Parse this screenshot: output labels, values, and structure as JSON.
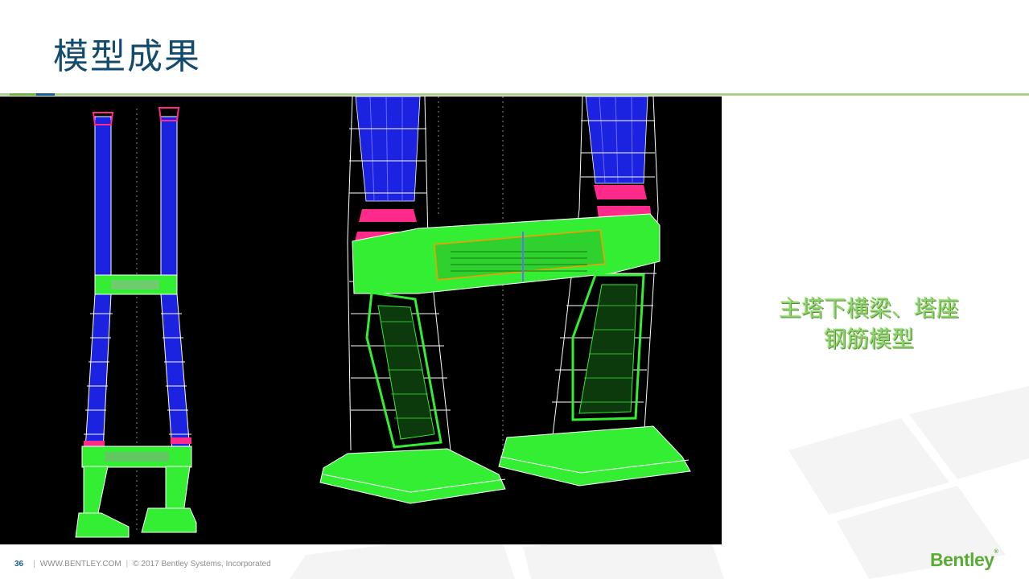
{
  "slide": {
    "title": "模型成果",
    "caption_line1": "主塔下横梁、塔座",
    "caption_line2": "钢筋模型",
    "footer": {
      "page_number": "36",
      "website": "WWW.BENTLEY.COM",
      "copyright": "© 2017 Bentley Systems, Incorporated"
    },
    "logo_text": "Bentley",
    "logo_mark": "®"
  },
  "colors": {
    "title": "#124b6e",
    "rule": "#a8d08d",
    "caption": "#8ed36b",
    "logo": "#5cab37",
    "rebar_green": "#33ee33",
    "rebar_blue": "#1b22e0",
    "rebar_magenta": "#ff2a8a"
  },
  "icons": {
    "logo": "bentley-logo"
  }
}
